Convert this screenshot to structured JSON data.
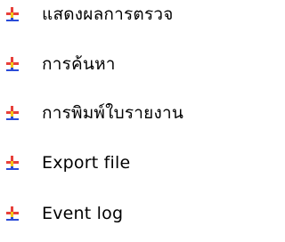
{
  "menu": {
    "items": [
      {
        "label": "แสดงผลการตรวจ",
        "icon": "pushpin-bullet-icon"
      },
      {
        "label": "การค้นหา",
        "icon": "pushpin-bullet-icon"
      },
      {
        "label": "การพิมพ์ใบรายงาน",
        "icon": "pushpin-bullet-icon"
      },
      {
        "label": "Export file",
        "icon": "pushpin-bullet-icon"
      },
      {
        "label": "Event log",
        "icon": "pushpin-bullet-icon"
      }
    ]
  },
  "colors": {
    "bullet_red": "#e8403a",
    "bullet_yellow": "#f2c81a",
    "bullet_blue": "#2a4bd8",
    "text": "#000000"
  }
}
